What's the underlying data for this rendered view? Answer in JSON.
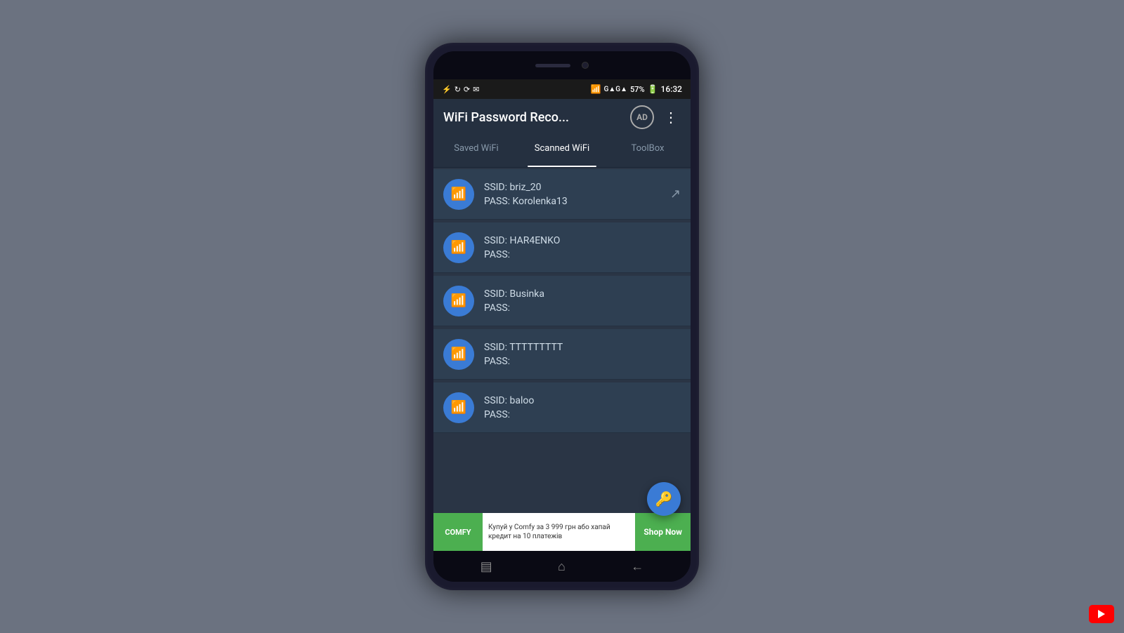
{
  "background": {
    "color": "#6b7280"
  },
  "statusBar": {
    "icons_left": [
      "usb-icon",
      "sync-icon",
      "refresh-icon",
      "mail-icon"
    ],
    "wifi": "WiFi",
    "signal": "G▲G▲",
    "battery": "57%",
    "time": "16:32"
  },
  "header": {
    "title": "WiFi Password Reco...",
    "ad_label": "AD",
    "more_label": "⋮"
  },
  "tabs": [
    {
      "id": "saved",
      "label": "Saved WiFi",
      "active": false
    },
    {
      "id": "scanned",
      "label": "Scanned WiFi",
      "active": true
    },
    {
      "id": "toolbox",
      "label": "ToolBox",
      "active": false
    }
  ],
  "wifiList": [
    {
      "ssid_label": "SSID:",
      "ssid_value": "briz_20",
      "pass_label": "PASS:",
      "pass_value": "Korolenka13",
      "has_share": true
    },
    {
      "ssid_label": "SSID:",
      "ssid_value": "HAR4ENKO",
      "pass_label": "PASS:",
      "pass_value": "",
      "has_share": false
    },
    {
      "ssid_label": "SSID:",
      "ssid_value": "Businka",
      "pass_label": "PASS:",
      "pass_value": "",
      "has_share": false
    },
    {
      "ssid_label": "SSID:",
      "ssid_value": "TTTTTTTTT",
      "pass_label": "PASS:",
      "pass_value": "",
      "has_share": false
    },
    {
      "ssid_label": "SSID:",
      "ssid_value": "baloo",
      "pass_label": "PASS:",
      "pass_value": "",
      "has_share": false
    }
  ],
  "fab": {
    "icon": "🔑"
  },
  "adBanner": {
    "logo": "COMFY",
    "text": "Купуй у Comfy за 3 999 грн або хапай кредит на 10 платежів",
    "cta": "Shop Now"
  },
  "bottomNav": {
    "menu_icon": "▤",
    "home_icon": "⌂",
    "back_icon": "←"
  }
}
